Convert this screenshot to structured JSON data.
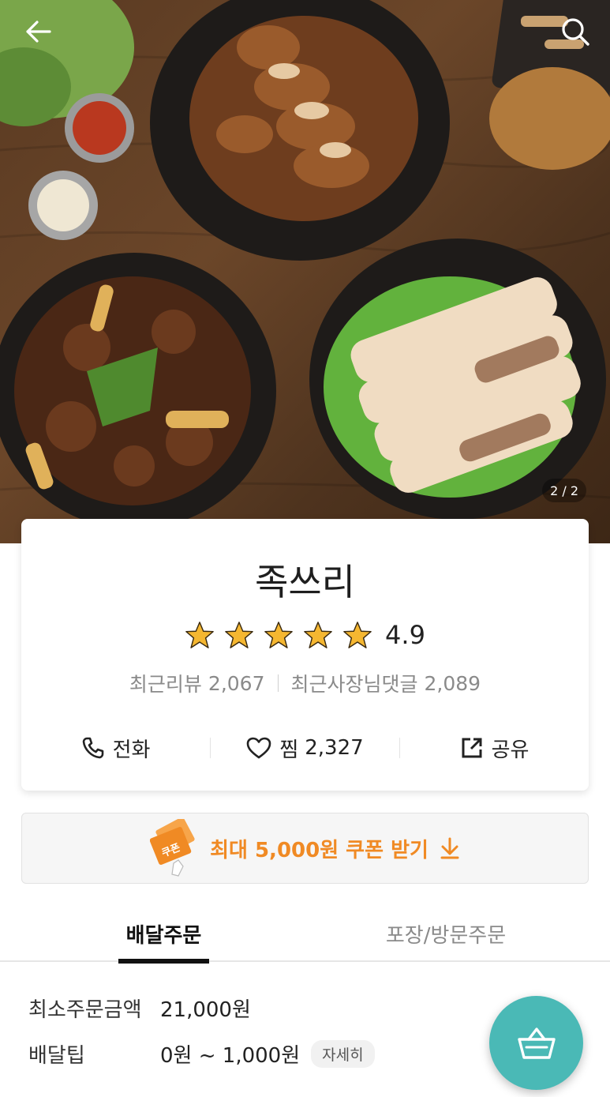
{
  "hero": {
    "image_counter": "2 / 2",
    "icons": {
      "back": "arrow-left-icon",
      "search": "search-icon"
    }
  },
  "store": {
    "name": "족쓰리",
    "rating": "4.9",
    "star_count": 5,
    "recent_reviews_label": "최근리뷰",
    "recent_reviews_count": "2,067",
    "owner_replies_label": "최근사장님댓글",
    "owner_replies_count": "2,089"
  },
  "actions": {
    "call_label": "전화",
    "favorite_label": "찜",
    "favorite_count": "2,327",
    "share_label": "공유"
  },
  "coupon": {
    "badge_text": "쿠폰",
    "label": "최대 5,000원 쿠폰 받기"
  },
  "tabs": {
    "delivery": "배달주문",
    "pickup": "포장/방문주문"
  },
  "delivery_info": {
    "min_order_label": "최소주문금액",
    "min_order_value": "21,000원",
    "tip_label": "배달팁",
    "tip_value": "0원 ~ 1,000원",
    "detail_button": "자세히"
  },
  "colors": {
    "accent_orange": "#f08a24",
    "cart_teal": "#4ab9b6",
    "star_gold": "#f5b731"
  }
}
